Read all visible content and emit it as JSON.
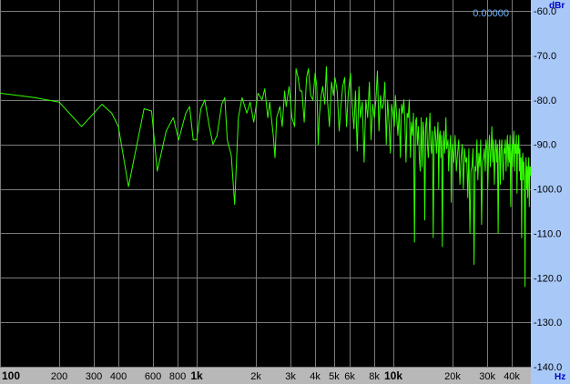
{
  "colors": {
    "background": "#000000",
    "grid": "#7a7a7a",
    "trace": "#33ff00",
    "axis_panel": "#a8c8f8",
    "x_axis_panel": "#b8b8b8",
    "unit_label": "#0000c8",
    "readout": "#6fb4ff"
  },
  "readout_value": "0.00000",
  "chart_data": {
    "type": "line",
    "x_scale": "log",
    "xlim": [
      100,
      50000
    ],
    "ylim": [
      -140,
      -60
    ],
    "grid": true,
    "x_unit": "Hz",
    "y_unit": "dBr",
    "x_ticks": [
      {
        "value": 100,
        "label": "100",
        "bold": true
      },
      {
        "value": 200,
        "label": "200",
        "bold": false
      },
      {
        "value": 300,
        "label": "300",
        "bold": false
      },
      {
        "value": 400,
        "label": "400",
        "bold": false
      },
      {
        "value": 600,
        "label": "600",
        "bold": false
      },
      {
        "value": 800,
        "label": "800",
        "bold": false
      },
      {
        "value": 1000,
        "label": "1k",
        "bold": true
      },
      {
        "value": 2000,
        "label": "2k",
        "bold": false
      },
      {
        "value": 3000,
        "label": "3k",
        "bold": false
      },
      {
        "value": 4000,
        "label": "4k",
        "bold": false
      },
      {
        "value": 5000,
        "label": "5k",
        "bold": false
      },
      {
        "value": 6000,
        "label": "6k",
        "bold": false
      },
      {
        "value": 8000,
        "label": "8k",
        "bold": false
      },
      {
        "value": 10000,
        "label": "10k",
        "bold": true
      },
      {
        "value": 20000,
        "label": "20k",
        "bold": false
      },
      {
        "value": 30000,
        "label": "30k",
        "bold": false
      },
      {
        "value": 40000,
        "label": "40k",
        "bold": false
      }
    ],
    "y_ticks": [
      {
        "value": -60,
        "label": "-60.0"
      },
      {
        "value": -70,
        "label": "-70.0"
      },
      {
        "value": -80,
        "label": "-80.0"
      },
      {
        "value": -90,
        "label": "-90.0"
      },
      {
        "value": -100,
        "label": "-100.0"
      },
      {
        "value": -110,
        "label": "-110.0"
      },
      {
        "value": -120,
        "label": "-120.0"
      },
      {
        "value": -130,
        "label": "-130.0"
      },
      {
        "value": -140,
        "label": "-140.0"
      }
    ],
    "series": [
      {
        "points": [
          [
            100,
            -78.5
          ],
          [
            150,
            -79.5
          ],
          [
            200,
            -80.5
          ],
          [
            260,
            -86
          ],
          [
            330,
            -81
          ],
          [
            370,
            -83
          ],
          [
            400,
            -86
          ],
          [
            450,
            -99.5
          ],
          [
            540,
            -82
          ],
          [
            590,
            -82.5
          ],
          [
            630,
            -96
          ],
          [
            700,
            -87
          ],
          [
            760,
            -84
          ],
          [
            810,
            -89
          ],
          [
            880,
            -83
          ],
          [
            920,
            -81.5
          ],
          [
            960,
            -89
          ],
          [
            1000,
            -89
          ],
          [
            1050,
            -82
          ],
          [
            1100,
            -80
          ],
          [
            1160,
            -86
          ],
          [
            1210,
            -90
          ],
          [
            1270,
            -88
          ],
          [
            1340,
            -81
          ],
          [
            1390,
            -79.5
          ],
          [
            1430,
            -89
          ],
          [
            1500,
            -92.5
          ],
          [
            1560,
            -103.5
          ],
          [
            1630,
            -84
          ],
          [
            1700,
            -79.5
          ],
          [
            1800,
            -83
          ],
          [
            1870,
            -80.5
          ],
          [
            1950,
            -85
          ],
          [
            2050,
            -78.5
          ],
          [
            2150,
            -80
          ],
          [
            2220,
            -77.5
          ],
          [
            2300,
            -84
          ],
          [
            2350,
            -80.5
          ],
          [
            2450,
            -88
          ],
          [
            2500,
            -93
          ],
          [
            2550,
            -84
          ],
          [
            2650,
            -81.5
          ],
          [
            2720,
            -86
          ],
          [
            2800,
            -78
          ],
          [
            2850,
            -81.5
          ],
          [
            2950,
            -77
          ],
          [
            3050,
            -84
          ],
          [
            3150,
            -86
          ],
          [
            3200,
            -73
          ],
          [
            3280,
            -75
          ],
          [
            3350,
            -78
          ],
          [
            3430,
            -78
          ],
          [
            3520,
            -85
          ],
          [
            3620,
            -75
          ],
          [
            3700,
            -73
          ],
          [
            3800,
            -79
          ],
          [
            3900,
            -80
          ],
          [
            4000,
            -74
          ],
          [
            4080,
            -77
          ],
          [
            4150,
            -90
          ],
          [
            4200,
            -84
          ],
          [
            4280,
            -79.5
          ],
          [
            4370,
            -77
          ],
          [
            4480,
            -81
          ],
          [
            4560,
            -72.5
          ],
          [
            4620,
            -80
          ],
          [
            4730,
            -86
          ],
          [
            4850,
            -76
          ],
          [
            4960,
            -79
          ],
          [
            5050,
            -75
          ],
          [
            5180,
            -78
          ],
          [
            5300,
            -87
          ],
          [
            5400,
            -82
          ],
          [
            5520,
            -77
          ],
          [
            5650,
            -75
          ],
          [
            5780,
            -86
          ],
          [
            5900,
            -78.5
          ],
          [
            6050,
            -74
          ],
          [
            6150,
            -80
          ],
          [
            6300,
            -86.5
          ],
          [
            6420,
            -78
          ],
          [
            6550,
            -91.5
          ],
          [
            6680,
            -77
          ],
          [
            6800,
            -84
          ],
          [
            6950,
            -80.5
          ],
          [
            7100,
            -94
          ],
          [
            7250,
            -80
          ],
          [
            7400,
            -84
          ],
          [
            7550,
            -76
          ],
          [
            7700,
            -89
          ],
          [
            7850,
            -81
          ],
          [
            8000,
            -84
          ],
          [
            8150,
            -80
          ],
          [
            8300,
            -73.5
          ],
          [
            8450,
            -87
          ],
          [
            8600,
            -79
          ],
          [
            8750,
            -82
          ],
          [
            8900,
            -81
          ],
          [
            9050,
            -76
          ],
          [
            9200,
            -90
          ],
          [
            9350,
            -80
          ],
          [
            9500,
            -85
          ],
          [
            9650,
            -92
          ],
          [
            9800,
            -81
          ],
          [
            9950,
            -83
          ],
          [
            10100,
            -86
          ],
          [
            10250,
            -79
          ],
          [
            10400,
            -84
          ],
          [
            10550,
            -88
          ],
          [
            10700,
            -82
          ],
          [
            10850,
            -93
          ],
          [
            11000,
            -81
          ],
          [
            11150,
            -83
          ],
          [
            11300,
            -80
          ],
          [
            11450,
            -85
          ],
          [
            11600,
            -94
          ],
          [
            11750,
            -83
          ],
          [
            11900,
            -84
          ],
          [
            12050,
            -80
          ],
          [
            12200,
            -93
          ],
          [
            12350,
            -85
          ],
          [
            12500,
            -88
          ],
          [
            12650,
            -83
          ],
          [
            12800,
            -112
          ],
          [
            12950,
            -85
          ],
          [
            13100,
            -84
          ],
          [
            13250,
            -90
          ],
          [
            13400,
            -86
          ],
          [
            13550,
            -93
          ],
          [
            13700,
            -96
          ],
          [
            13850,
            -84
          ],
          [
            14000,
            -95
          ],
          [
            14150,
            -85
          ],
          [
            14300,
            -88
          ],
          [
            14450,
            -107
          ],
          [
            14600,
            -86
          ],
          [
            14750,
            -84
          ],
          [
            14900,
            -90
          ],
          [
            15050,
            -93
          ],
          [
            15200,
            -87
          ],
          [
            15350,
            -83
          ],
          [
            15500,
            -90
          ],
          [
            15650,
            -92
          ],
          [
            15800,
            -87
          ],
          [
            15950,
            -111
          ],
          [
            16100,
            -90
          ],
          [
            16250,
            -86
          ],
          [
            16400,
            -88
          ],
          [
            16550,
            -92
          ],
          [
            16700,
            -89
          ],
          [
            16850,
            -85
          ],
          [
            17000,
            -100
          ],
          [
            17150,
            -88
          ],
          [
            17300,
            -87
          ],
          [
            17450,
            -93
          ],
          [
            17600,
            -88
          ],
          [
            17750,
            -113
          ],
          [
            17900,
            -92
          ],
          [
            18050,
            -87
          ],
          [
            18200,
            -92
          ],
          [
            18350,
            -89
          ],
          [
            18500,
            -84
          ],
          [
            18650,
            -91
          ],
          [
            18800,
            -90
          ],
          [
            18950,
            -89
          ],
          [
            19100,
            -96
          ],
          [
            19250,
            -92
          ],
          [
            19400,
            -90
          ],
          [
            19550,
            -88
          ],
          [
            19700,
            -103
          ],
          [
            19850,
            -92
          ],
          [
            20000,
            -90
          ],
          [
            20300,
            -94
          ],
          [
            20600,
            -88
          ],
          [
            20900,
            -96
          ],
          [
            21200,
            -92
          ],
          [
            21500,
            -89
          ],
          [
            21800,
            -99
          ],
          [
            22100,
            -93
          ],
          [
            22400,
            -90
          ],
          [
            22700,
            -100
          ],
          [
            23000,
            -91
          ],
          [
            23300,
            -94
          ],
          [
            23600,
            -93
          ],
          [
            23900,
            -102
          ],
          [
            24200,
            -91
          ],
          [
            24500,
            -110
          ],
          [
            24800,
            -96
          ],
          [
            25100,
            -95
          ],
          [
            25400,
            -91
          ],
          [
            25700,
            -117
          ],
          [
            26000,
            -95
          ],
          [
            26300,
            -96
          ],
          [
            26600,
            -89
          ],
          [
            26900,
            -98
          ],
          [
            27200,
            -92
          ],
          [
            27500,
            -95
          ],
          [
            27800,
            -89
          ],
          [
            28100,
            -108
          ],
          [
            28400,
            -94
          ],
          [
            28700,
            -93
          ],
          [
            29000,
            -91
          ],
          [
            29300,
            -96
          ],
          [
            29600,
            -89
          ],
          [
            29900,
            -91
          ],
          [
            30200,
            -100
          ],
          [
            30500,
            -92
          ],
          [
            30800,
            -88
          ],
          [
            31100,
            -95
          ],
          [
            31400,
            -91
          ],
          [
            31700,
            -86
          ],
          [
            32000,
            -94
          ],
          [
            32300,
            -89
          ],
          [
            32600,
            -99
          ],
          [
            32900,
            -92
          ],
          [
            33200,
            -89
          ],
          [
            33500,
            -94
          ],
          [
            33800,
            -90
          ],
          [
            34100,
            -110
          ],
          [
            34400,
            -93
          ],
          [
            34700,
            -89
          ],
          [
            35000,
            -99
          ],
          [
            35300,
            -91
          ],
          [
            35600,
            -89
          ],
          [
            35900,
            -94
          ],
          [
            36200,
            -98
          ],
          [
            36500,
            -91
          ],
          [
            36800,
            -92
          ],
          [
            37100,
            -89
          ],
          [
            37400,
            -96
          ],
          [
            37700,
            -91
          ],
          [
            38000,
            -88
          ],
          [
            38300,
            -95
          ],
          [
            38600,
            -90
          ],
          [
            38900,
            -94
          ],
          [
            39200,
            -88
          ],
          [
            39500,
            -104
          ],
          [
            39800,
            -92
          ],
          [
            40100,
            -90
          ],
          [
            40400,
            -95
          ],
          [
            40700,
            -89
          ],
          [
            41000,
            -87
          ],
          [
            41300,
            -96
          ],
          [
            41600,
            -90
          ],
          [
            41900,
            -92
          ],
          [
            42200,
            -88
          ],
          [
            42500,
            -101
          ],
          [
            42800,
            -90
          ],
          [
            43100,
            -92
          ],
          [
            43400,
            -88
          ],
          [
            43700,
            -96
          ],
          [
            44000,
            -91
          ],
          [
            44300,
            -98
          ],
          [
            44600,
            -93
          ],
          [
            44900,
            -111
          ],
          [
            45200,
            -94
          ],
          [
            45500,
            -92
          ],
          [
            45800,
            -98
          ],
          [
            46100,
            -94
          ],
          [
            46400,
            -101
          ],
          [
            46700,
            -122
          ],
          [
            47000,
            -97
          ],
          [
            47300,
            -93
          ],
          [
            47600,
            -100
          ],
          [
            47900,
            -95
          ],
          [
            48200,
            -102
          ],
          [
            48500,
            -96
          ],
          [
            48800,
            -93
          ],
          [
            49100,
            -104
          ],
          [
            49400,
            -95
          ],
          [
            49700,
            -97
          ],
          [
            50000,
            -95
          ]
        ]
      }
    ]
  }
}
